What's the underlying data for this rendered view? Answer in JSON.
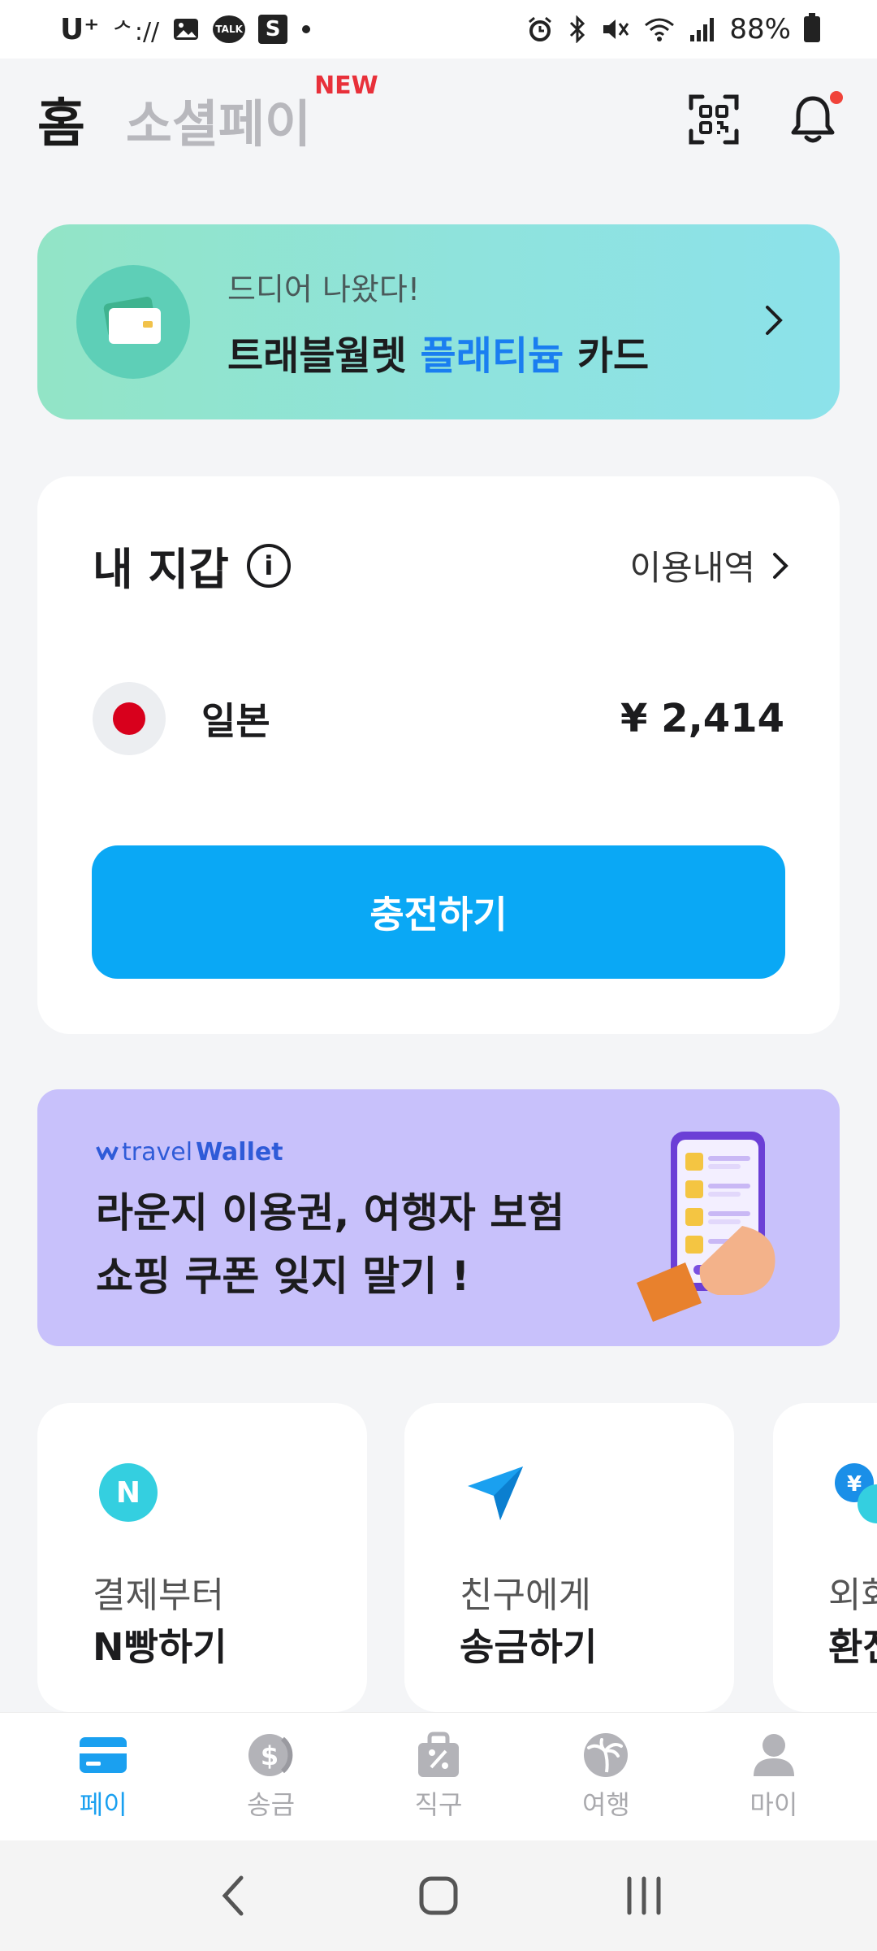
{
  "status_bar": {
    "carrier": "U⁺",
    "signal_text": "ᄼ:// ",
    "s_badge": "S",
    "talk_badge": "TALK",
    "battery_text": "88%"
  },
  "header": {
    "tab_home": "홈",
    "tab_social": "소셜페이",
    "new_badge": "NEW",
    "qr_icon": "qr-scan-icon",
    "bell_icon": "bell-icon"
  },
  "promo": {
    "subtitle": "드디어 나왔다!",
    "title_part1": "트래블월렛 ",
    "title_highlight": "플래티늄",
    "title_part2": " 카드",
    "highlight_color": "#1a7ef0"
  },
  "wallet": {
    "title": "내 지갑",
    "info_icon": "i",
    "history_label": "이용내역",
    "country": "일본",
    "currency_symbol": "¥",
    "amount": "2,414",
    "charge_label": "충전하기",
    "accent": "#0aa8f5"
  },
  "travel_banner": {
    "logo_prefix": "travel",
    "logo_bold": "Wallet",
    "line1": "라운지 이용권, 여행자 보험",
    "line2": "쇼핑 쿠폰 잊지 말기 !"
  },
  "features": [
    {
      "line1": "결제부터",
      "line2": "N빵하기",
      "icon": "n-badge-icon",
      "icon_text": "N"
    },
    {
      "line1": "친구에게",
      "line2": "송금하기",
      "icon": "send-plane-icon"
    },
    {
      "line1": "외화",
      "line2": "환전",
      "icon": "currency-exchange-icon",
      "icon_text": "¥"
    }
  ],
  "bottom_nav": [
    {
      "label": "페이",
      "icon": "card-icon",
      "active": true
    },
    {
      "label": "송금",
      "icon": "dollar-coin-icon",
      "active": false
    },
    {
      "label": "직구",
      "icon": "shopping-bag-percent-icon",
      "active": false
    },
    {
      "label": "여행",
      "icon": "palm-tree-icon",
      "active": false
    },
    {
      "label": "마이",
      "icon": "person-icon",
      "active": false
    }
  ]
}
